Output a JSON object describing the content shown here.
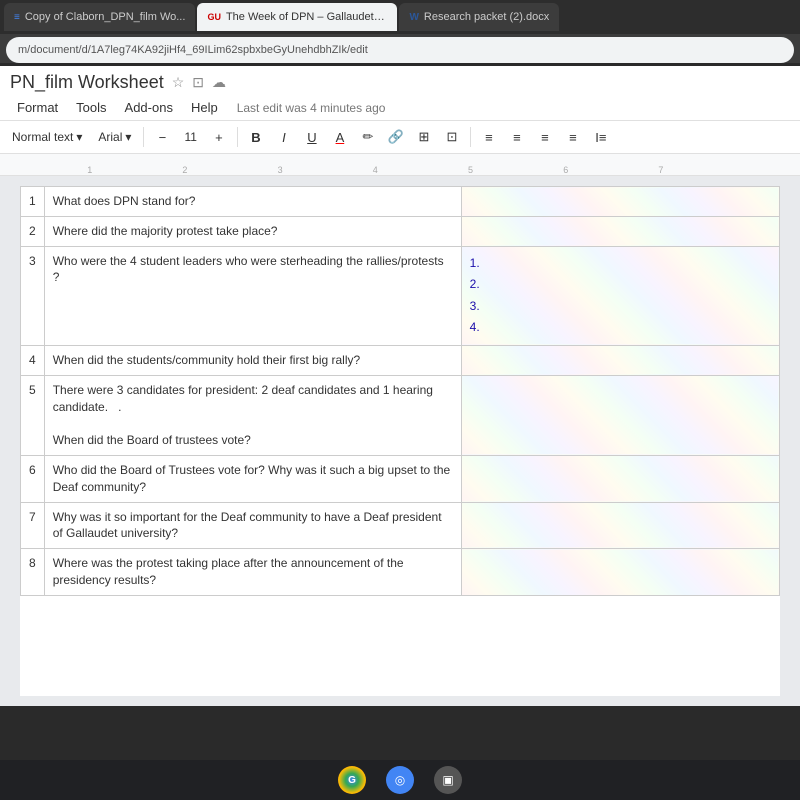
{
  "browser": {
    "tabs": [
      {
        "id": "tab-docs",
        "icon_type": "docs",
        "icon_char": "≡",
        "label": "Copy of Claborn_DPN_film Wo...",
        "active": false
      },
      {
        "id": "tab-gallaudet",
        "icon_type": "gallaudet",
        "icon_char": "GU",
        "label": "The Week of DPN – Gallaudet U...",
        "active": true
      },
      {
        "id": "tab-word",
        "icon_type": "word",
        "icon_char": "W",
        "label": "Research packet (2).docx",
        "active": false
      }
    ],
    "address": "m/document/d/1A7leg74KA92jiHf4_69ILim62spbxbeGyUnehdbhZIk/edit"
  },
  "docs": {
    "title": "PN_film Worksheet",
    "menu": {
      "items": [
        "Format",
        "Tools",
        "Add-ons",
        "Help"
      ],
      "last_edit": "Last edit was 4 minutes ago"
    },
    "toolbar": {
      "style_label": "Normal text",
      "font_label": "Arial",
      "font_minus": "−",
      "font_size": "11",
      "font_plus": "+",
      "bold": "B",
      "italic": "I",
      "underline": "U",
      "font_color": "A"
    },
    "ruler": {
      "marks": [
        "1",
        "2",
        "3",
        "4",
        "5",
        "6",
        "7"
      ]
    },
    "table": {
      "rows": [
        {
          "num": "1",
          "question": "What does DPN stand for?",
          "answer": ""
        },
        {
          "num": "2",
          "question": "Where did the majority protest take place?",
          "answer": ""
        },
        {
          "num": "3",
          "question": "Who were the 4 student leaders who were sterheading the rallies/protests ?",
          "answer": "",
          "numbered": [
            "1.",
            "2.",
            "3.",
            "4."
          ]
        },
        {
          "num": "4",
          "question": "When did the students/community hold their first big rally?",
          "answer": ""
        },
        {
          "num": "5",
          "question": "There were 3 candidates for president: 2 deaf candidates and 1 hearing candidate.\n\nWhen did the Board of trustees vote?",
          "answer": ""
        },
        {
          "num": "6",
          "question": "Who did the Board of Trustees vote for? Why was it such a big upset to the Deaf community?",
          "answer": ""
        },
        {
          "num": "7",
          "question": "Why was it so important for the Deaf community to have a Deaf president of Gallaudet university?",
          "answer": ""
        },
        {
          "num": "8",
          "question": "Where was the protest taking place after the announcement of the presidency results?",
          "answer": ""
        }
      ]
    }
  },
  "taskbar": {
    "icons": [
      "●",
      "◎",
      "▣"
    ]
  }
}
